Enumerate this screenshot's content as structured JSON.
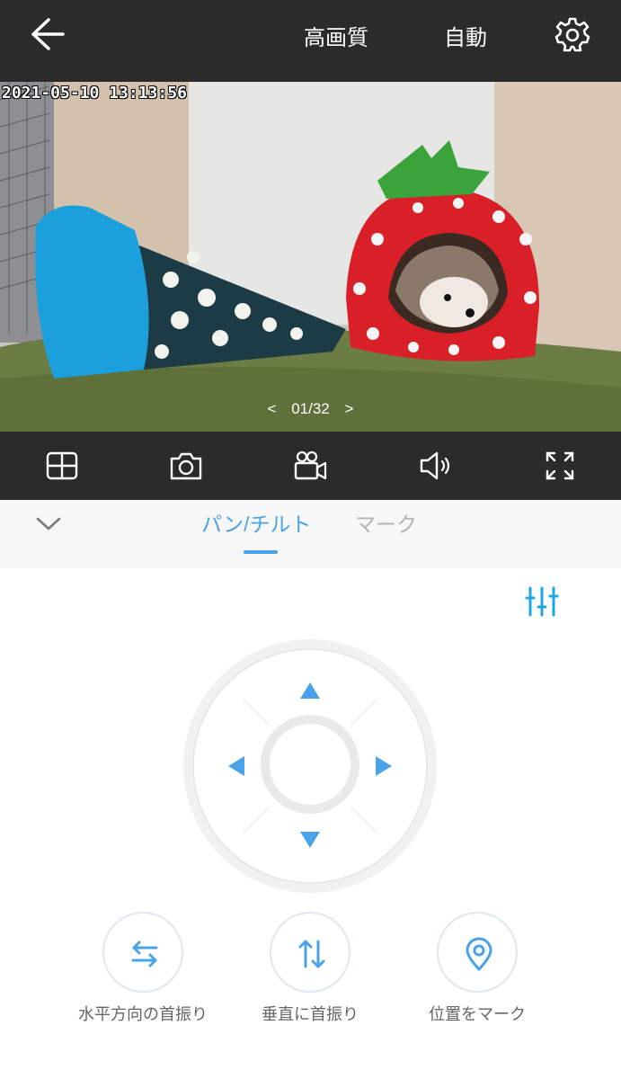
{
  "header": {
    "back_icon": "arrow-left-icon",
    "quality_label": "高画質",
    "mode_label": "自動",
    "settings_icon": "gear-icon"
  },
  "video": {
    "timestamp": "2021-05-10 13:13:56",
    "pager": {
      "prev": "<",
      "current": "01/32",
      "next": ">"
    }
  },
  "toolbar": {
    "icons": [
      "grid-icon",
      "camera-icon",
      "video-record-icon",
      "speaker-icon",
      "fullscreen-icon"
    ]
  },
  "tabs": {
    "collapse_icon": "chevron-down-icon",
    "items": [
      {
        "label": "パン/チルト",
        "active": true
      },
      {
        "label": "マーク",
        "active": false
      }
    ]
  },
  "controls": {
    "adjust_icon": "sliders-icon",
    "dpad_icons": [
      "arrow-up-icon",
      "arrow-left-icon",
      "arrow-right-icon",
      "arrow-down-icon"
    ],
    "actions": [
      {
        "label": "水平方向の首振り",
        "icon": "horizontal-swap-icon"
      },
      {
        "label": "垂直に首振り",
        "icon": "vertical-swap-icon"
      },
      {
        "label": "位置をマーク",
        "icon": "location-pin-icon"
      }
    ]
  },
  "colors": {
    "accent": "#4aa3e8",
    "bar": "#2b2b2b",
    "inactive_tab": "#b3b3b3"
  }
}
